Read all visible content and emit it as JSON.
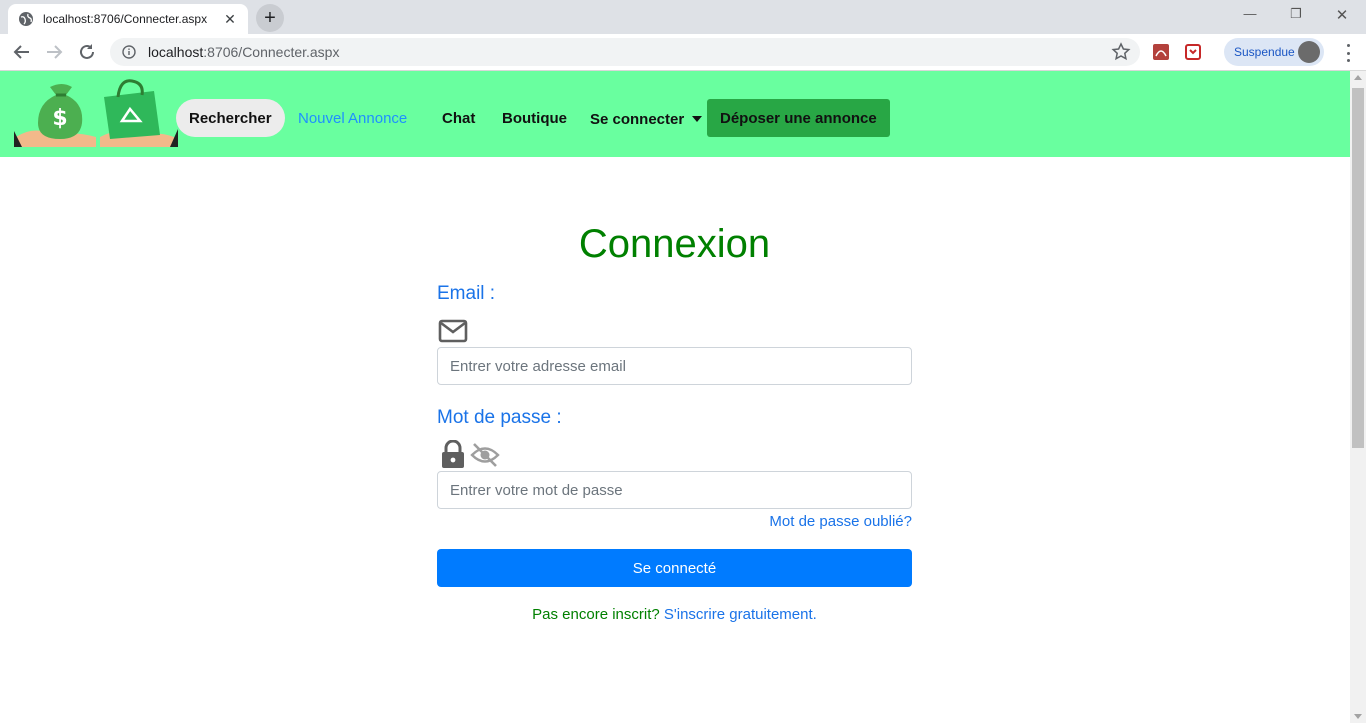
{
  "browser": {
    "tab_title": "localhost:8706/Connecter.aspx",
    "url_host": "localhost",
    "url_rest": ":8706/Connecter.aspx",
    "profile_label": "Suspendue"
  },
  "site_nav": {
    "items": [
      {
        "label": "Rechercher"
      },
      {
        "label": "Nouvel Annonce"
      },
      {
        "label": "Chat"
      },
      {
        "label": "Boutique"
      },
      {
        "label": "Se connecter"
      }
    ],
    "cta_label": "Déposer une annonce",
    "bg_color": "#69ff9f"
  },
  "login": {
    "title": "Connexion",
    "email_label": "Email :",
    "email_placeholder": "Entrer votre adresse email",
    "password_label": "Mot de passe :",
    "password_placeholder": "Entrer votre mot de passe",
    "forgot_label": "Mot de passe oublié?",
    "submit_label": "Se connecté",
    "signup_prompt": "Pas encore inscrit?",
    "signup_link": "S'inscrire gratuitement."
  },
  "icons": [
    "mail-icon",
    "lock-icon",
    "eye-slash-icon"
  ]
}
